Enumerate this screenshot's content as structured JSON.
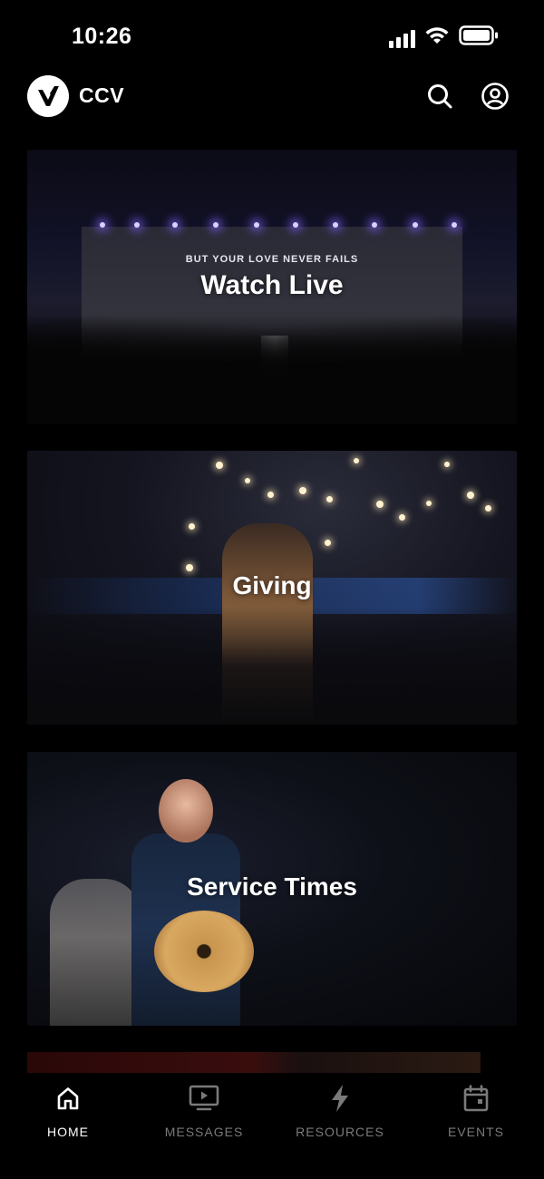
{
  "status_bar": {
    "time": "10:26"
  },
  "header": {
    "brand": "CCV",
    "icons": [
      "search-icon",
      "profile-icon"
    ]
  },
  "cards": [
    {
      "title": "Watch Live",
      "screen_text": "BUT YOUR LOVE NEVER FAILS"
    },
    {
      "title": "Giving"
    },
    {
      "title": "Service Times"
    }
  ],
  "tab_bar": {
    "tabs": [
      {
        "label": "HOME",
        "icon": "home-icon",
        "active": true
      },
      {
        "label": "MESSAGES",
        "icon": "tv-icon",
        "active": false
      },
      {
        "label": "RESOURCES",
        "icon": "bolt-icon",
        "active": false
      },
      {
        "label": "EVENTS",
        "icon": "calendar-icon",
        "active": false
      }
    ]
  },
  "colors": {
    "background": "#000000",
    "active_tab": "#ffffff",
    "inactive_tab": "#7a7a7a"
  }
}
